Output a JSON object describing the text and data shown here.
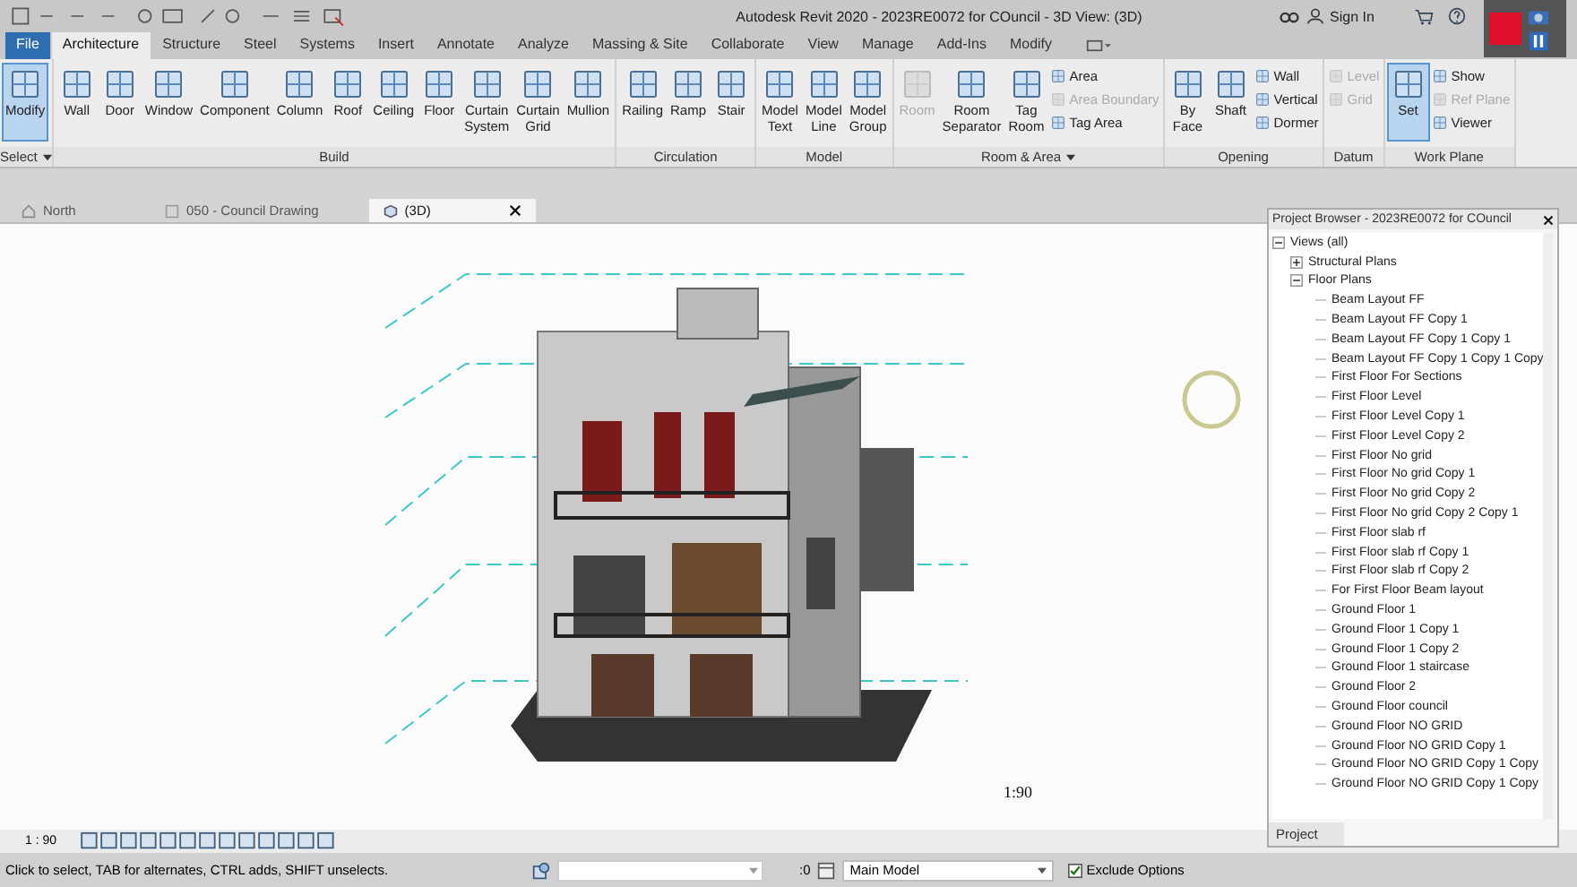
{
  "window": {
    "title": "Autodesk Revit 2020 - 2023RE0072 for COuncil - 3D View: (3D)",
    "sign_in": "Sign In"
  },
  "ribbon_tabs": [
    {
      "label": "File",
      "kind": "file",
      "selected": false
    },
    {
      "label": "Architecture",
      "kind": "tab",
      "selected": true
    },
    {
      "label": "Structure",
      "kind": "tab",
      "selected": false
    },
    {
      "label": "Steel",
      "kind": "tab",
      "selected": false
    },
    {
      "label": "Systems",
      "kind": "tab",
      "selected": false
    },
    {
      "label": "Insert",
      "kind": "tab",
      "selected": false
    },
    {
      "label": "Annotate",
      "kind": "tab",
      "selected": false
    },
    {
      "label": "Analyze",
      "kind": "tab",
      "selected": false
    },
    {
      "label": "Massing & Site",
      "kind": "tab",
      "selected": false
    },
    {
      "label": "Collaborate",
      "kind": "tab",
      "selected": false
    },
    {
      "label": "View",
      "kind": "tab",
      "selected": false
    },
    {
      "label": "Manage",
      "kind": "tab",
      "selected": false
    },
    {
      "label": "Add-Ins",
      "kind": "tab",
      "selected": false
    },
    {
      "label": "Modify",
      "kind": "tab",
      "selected": false
    }
  ],
  "ribbon_panels": [
    {
      "label": "Select",
      "dropdown": true,
      "tools": [
        {
          "kind": "big",
          "label": "Modify",
          "selected": true,
          "disabled": false
        }
      ]
    },
    {
      "label": "Build",
      "dropdown": false,
      "tools": [
        {
          "kind": "big",
          "label": "Wall",
          "selected": false,
          "disabled": false
        },
        {
          "kind": "big",
          "label": "Door",
          "selected": false,
          "disabled": false
        },
        {
          "kind": "big",
          "label": "Window",
          "selected": false,
          "disabled": false
        },
        {
          "kind": "big",
          "label": "Component",
          "selected": false,
          "disabled": false
        },
        {
          "kind": "big",
          "label": "Column",
          "selected": false,
          "disabled": false
        },
        {
          "kind": "big",
          "label": "Roof",
          "selected": false,
          "disabled": false
        },
        {
          "kind": "big",
          "label": "Ceiling",
          "selected": false,
          "disabled": false
        },
        {
          "kind": "big",
          "label": "Floor",
          "selected": false,
          "disabled": false
        },
        {
          "kind": "big",
          "label": "Curtain System",
          "selected": false,
          "disabled": false
        },
        {
          "kind": "big",
          "label": "Curtain Grid",
          "selected": false,
          "disabled": false
        },
        {
          "kind": "big",
          "label": "Mullion",
          "selected": false,
          "disabled": false
        }
      ]
    },
    {
      "label": "Circulation",
      "dropdown": false,
      "tools": [
        {
          "kind": "big",
          "label": "Railing",
          "selected": false,
          "disabled": false
        },
        {
          "kind": "big",
          "label": "Ramp",
          "selected": false,
          "disabled": false
        },
        {
          "kind": "big",
          "label": "Stair",
          "selected": false,
          "disabled": false
        }
      ]
    },
    {
      "label": "Model",
      "dropdown": false,
      "tools": [
        {
          "kind": "big",
          "label": "Model Text",
          "selected": false,
          "disabled": false
        },
        {
          "kind": "big",
          "label": "Model Line",
          "selected": false,
          "disabled": false
        },
        {
          "kind": "big",
          "label": "Model Group",
          "selected": false,
          "disabled": false
        }
      ]
    },
    {
      "label": "Room & Area",
      "dropdown": true,
      "tools": [
        {
          "kind": "big",
          "label": "Room",
          "selected": false,
          "disabled": true
        },
        {
          "kind": "big",
          "label": "Room Separator",
          "selected": false,
          "disabled": false
        },
        {
          "kind": "big",
          "label": "Tag Room",
          "selected": false,
          "disabled": false
        },
        {
          "kind": "stack",
          "items": [
            {
              "label": "Area",
              "disabled": false
            },
            {
              "label": "Area Boundary",
              "disabled": true
            },
            {
              "label": "Tag Area",
              "disabled": false
            }
          ]
        }
      ]
    },
    {
      "label": "Opening",
      "dropdown": false,
      "tools": [
        {
          "kind": "big",
          "label": "By Face",
          "selected": false,
          "disabled": false
        },
        {
          "kind": "big",
          "label": "Shaft",
          "selected": false,
          "disabled": false
        },
        {
          "kind": "stack",
          "items": [
            {
              "label": "Wall",
              "disabled": false
            },
            {
              "label": "Vertical",
              "disabled": false
            },
            {
              "label": "Dormer",
              "disabled": false
            }
          ]
        }
      ]
    },
    {
      "label": "Datum",
      "dropdown": false,
      "tools": [
        {
          "kind": "stack",
          "items": [
            {
              "label": "Level",
              "disabled": true
            },
            {
              "label": "Grid",
              "disabled": true
            }
          ]
        }
      ]
    },
    {
      "label": "Work Plane",
      "dropdown": false,
      "tools": [
        {
          "kind": "big",
          "label": "Set",
          "selected": true,
          "disabled": false
        },
        {
          "kind": "stack",
          "items": [
            {
              "label": "Show",
              "disabled": false
            },
            {
              "label": "Ref Plane",
              "disabled": true
            },
            {
              "label": "Viewer",
              "disabled": false
            }
          ]
        }
      ]
    }
  ],
  "view_tabs": [
    {
      "label": "North",
      "kind": "plan",
      "selected": false
    },
    {
      "label": "050 - Council Drawing",
      "kind": "sheet",
      "selected": false
    },
    {
      "label": "(3D)",
      "kind": "model",
      "selected": true
    }
  ],
  "view": {
    "scale_label": "1:90"
  },
  "project_browser": {
    "title": "Project Browser - 2023RE0072 for COuncil",
    "tab": "Project",
    "tree": [
      {
        "label": "Views (all)",
        "expanded": true,
        "children": [
          {
            "label": "Structural Plans",
            "expanded": false
          },
          {
            "label": "Floor Plans",
            "expanded": true,
            "children": [
              {
                "label": "Beam Layout FF"
              },
              {
                "label": "Beam Layout FF Copy 1"
              },
              {
                "label": "Beam Layout FF Copy 1 Copy 1"
              },
              {
                "label": "Beam Layout FF Copy 1 Copy 1 Copy"
              },
              {
                "label": "First Floor For Sections"
              },
              {
                "label": "First Floor Level"
              },
              {
                "label": "First Floor Level Copy 1"
              },
              {
                "label": "First Floor Level Copy 2"
              },
              {
                "label": "First Floor No grid"
              },
              {
                "label": "First Floor No grid Copy 1"
              },
              {
                "label": "First Floor No grid Copy 2"
              },
              {
                "label": "First Floor No grid Copy 2 Copy 1"
              },
              {
                "label": "First Floor slab rf"
              },
              {
                "label": "First Floor slab rf Copy 1"
              },
              {
                "label": "First Floor slab rf Copy 2"
              },
              {
                "label": "For First Floor Beam layout"
              },
              {
                "label": "Ground Floor 1"
              },
              {
                "label": "Ground Floor 1 Copy 1"
              },
              {
                "label": "Ground Floor 1 Copy 2"
              },
              {
                "label": "Ground Floor 1 staircase"
              },
              {
                "label": "Ground Floor 2"
              },
              {
                "label": "Ground Floor council"
              },
              {
                "label": "Ground Floor NO GRID"
              },
              {
                "label": "Ground Floor NO GRID Copy 1"
              },
              {
                "label": "Ground Floor NO GRID Copy 1 Copy"
              },
              {
                "label": "Ground Floor NO GRID Copy 1 Copy"
              }
            ]
          }
        ]
      }
    ]
  },
  "view_control_bar": {
    "scale": "1 : 90"
  },
  "status_bar": {
    "message": "Click to select, TAB for alternates, CTRL adds, SHIFT unselects.",
    "filter_count": ":0",
    "model": "Main Model",
    "exclude_options": {
      "label": "Exclude Options",
      "checked": true
    }
  }
}
